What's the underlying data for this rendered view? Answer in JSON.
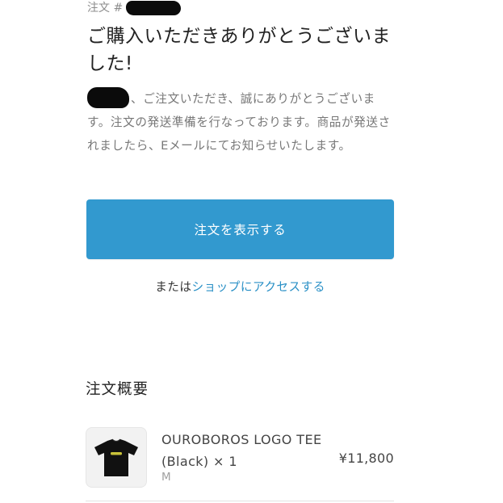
{
  "header": {
    "order_label": "注文 #"
  },
  "thanks": {
    "title": "ご購入いただきありがとうございました!",
    "message_after_name": "、ご注文いただき、誠にありがとうございます。注文の発送準備を行なっております。商品が発送されましたら、Eメールにてお知らせいたします。"
  },
  "actions": {
    "view_order_label": "注文を表示する",
    "or_prefix": "または",
    "shop_link_label": "ショップにアクセスする"
  },
  "summary": {
    "title": "注文概要",
    "items": [
      {
        "name": "OUROBOROS LOGO TEE (Black) × 1",
        "variant": "M",
        "price": "¥11,800"
      }
    ]
  },
  "colors": {
    "button": "#3299cf",
    "link": "#2a90c6",
    "muted_text": "#777777",
    "redaction": "#0b0b0b"
  },
  "icons": {
    "product_image": "black-tshirt-thumbnail"
  }
}
